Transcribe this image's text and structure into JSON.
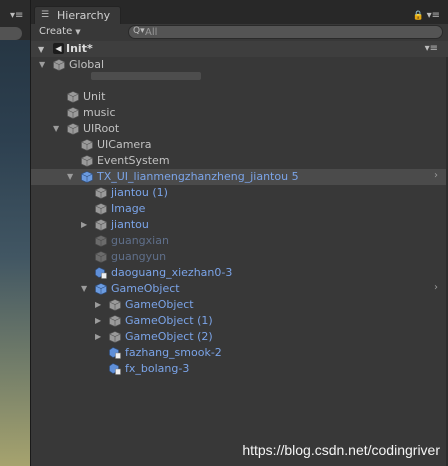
{
  "toolbar": {
    "tab_label": "Hierarchy",
    "create_label": "Create",
    "search_placeholder": "All"
  },
  "colors": {
    "normal": "#c2c2c2",
    "prefab": "#7ba4e8",
    "inactive_prefab": "#5f6f8a",
    "selected_bg": "#4b4b4b"
  },
  "scene": {
    "name": "Init*"
  },
  "tree": [
    {
      "label": "Global",
      "depth": 1,
      "arrow": "expanded",
      "icon": "cube",
      "style": "normal"
    },
    {
      "label": "Unit",
      "depth": 2,
      "arrow": "none",
      "icon": "cube",
      "style": "normal"
    },
    {
      "label": "music",
      "depth": 2,
      "arrow": "none",
      "icon": "cube",
      "style": "normal"
    },
    {
      "label": "UIRoot",
      "depth": 2,
      "arrow": "expanded",
      "icon": "cube",
      "style": "normal"
    },
    {
      "label": "UICamera",
      "depth": 3,
      "arrow": "none",
      "icon": "cube",
      "style": "normal"
    },
    {
      "label": "EventSystem",
      "depth": 3,
      "arrow": "none",
      "icon": "cube",
      "style": "normal"
    },
    {
      "label": "TX_UI_lianmengzhanzheng_jiantou 5",
      "depth": 3,
      "arrow": "expanded",
      "icon": "prefab",
      "style": "prefab",
      "selected": true,
      "chevron": true
    },
    {
      "label": "jiantou (1)",
      "depth": 4,
      "arrow": "none",
      "icon": "cube",
      "style": "prefab"
    },
    {
      "label": "Image",
      "depth": 4,
      "arrow": "none",
      "icon": "cube",
      "style": "prefab"
    },
    {
      "label": "jiantou",
      "depth": 4,
      "arrow": "collapsed",
      "icon": "cube",
      "style": "prefab"
    },
    {
      "label": "guangxian",
      "depth": 4,
      "arrow": "none",
      "icon": "cube",
      "style": "inactive"
    },
    {
      "label": "guangyun",
      "depth": 4,
      "arrow": "none",
      "icon": "cube",
      "style": "inactive"
    },
    {
      "label": "daoguang_xiezhan0-3",
      "depth": 4,
      "arrow": "none",
      "icon": "prefab-doc",
      "style": "prefab"
    },
    {
      "label": "GameObject",
      "depth": 4,
      "arrow": "expanded",
      "icon": "prefab",
      "style": "prefab",
      "chevron": true
    },
    {
      "label": "GameObject",
      "depth": 5,
      "arrow": "collapsed",
      "icon": "cube",
      "style": "prefab"
    },
    {
      "label": "GameObject (1)",
      "depth": 5,
      "arrow": "collapsed",
      "icon": "cube",
      "style": "prefab"
    },
    {
      "label": "GameObject (2)",
      "depth": 5,
      "arrow": "collapsed",
      "icon": "cube",
      "style": "prefab"
    },
    {
      "label": "fazhang_smook-2",
      "depth": 5,
      "arrow": "none",
      "icon": "prefab-doc",
      "style": "prefab"
    },
    {
      "label": "fx_bolang-3",
      "depth": 5,
      "arrow": "none",
      "icon": "prefab-doc",
      "style": "prefab"
    }
  ],
  "watermark": "https://blog.csdn.net/codingriver"
}
